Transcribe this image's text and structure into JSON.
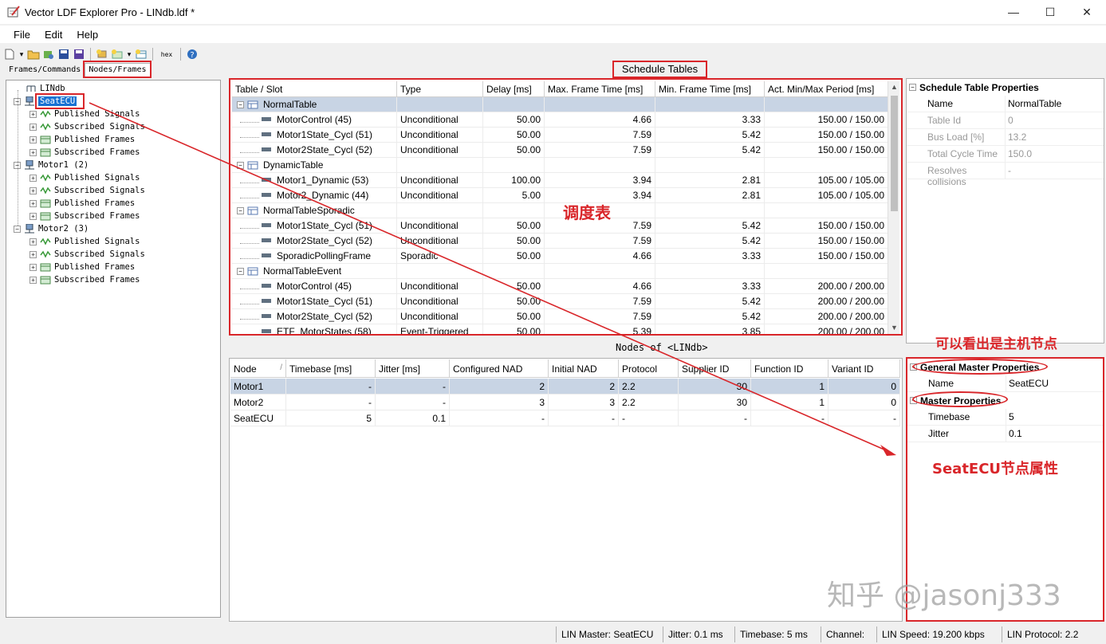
{
  "window": {
    "title": "Vector LDF Explorer Pro - LINdb.ldf *",
    "minimize": "—",
    "maximize": "☐",
    "close": "✕"
  },
  "menu": [
    "File",
    "Edit",
    "Help"
  ],
  "toolbar": {
    "hex": "hex"
  },
  "left_tabs": [
    "Frames/Commands",
    "Nodes/Frames"
  ],
  "tree": {
    "root": "LINdb",
    "nodes": [
      {
        "label": "SeatECU",
        "children": [
          "Published Signals",
          "Subscribed Signals",
          "Published Frames",
          "Subscribed Frames"
        ]
      },
      {
        "label": "Motor1 (2)",
        "children": [
          "Published Signals",
          "Subscribed Signals",
          "Published Frames",
          "Subscribed Frames"
        ]
      },
      {
        "label": "Motor2 (3)",
        "children": [
          "Published Signals",
          "Subscribed Signals",
          "Published Frames",
          "Subscribed Frames"
        ]
      }
    ]
  },
  "schedule": {
    "title": "Schedule Tables",
    "columns": [
      "Table / Slot",
      "Type",
      "Delay [ms]",
      "Max. Frame Time [ms]",
      "Min. Frame Time [ms]",
      "Act. Min/Max Period [ms]"
    ],
    "rows": [
      {
        "group": true,
        "name": "NormalTable"
      },
      {
        "name": "MotorControl (45)",
        "type": "Unconditional",
        "delay": "50.00",
        "max": "4.66",
        "min": "3.33",
        "period": "150.00 / 150.00"
      },
      {
        "name": "Motor1State_Cycl (51)",
        "type": "Unconditional",
        "delay": "50.00",
        "max": "7.59",
        "min": "5.42",
        "period": "150.00 / 150.00"
      },
      {
        "name": "Motor2State_Cycl (52)",
        "type": "Unconditional",
        "delay": "50.00",
        "max": "7.59",
        "min": "5.42",
        "period": "150.00 / 150.00"
      },
      {
        "group": true,
        "name": "DynamicTable"
      },
      {
        "name": "Motor1_Dynamic (53)",
        "type": "Unconditional",
        "delay": "100.00",
        "max": "3.94",
        "min": "2.81",
        "period": "105.00 / 105.00"
      },
      {
        "name": "Motor2_Dynamic (44)",
        "type": "Unconditional",
        "delay": "5.00",
        "max": "3.94",
        "min": "2.81",
        "period": "105.00 / 105.00"
      },
      {
        "group": true,
        "name": "NormalTableSporadic"
      },
      {
        "name": "Motor1State_Cycl (51)",
        "type": "Unconditional",
        "delay": "50.00",
        "max": "7.59",
        "min": "5.42",
        "period": "150.00 / 150.00"
      },
      {
        "name": "Motor2State_Cycl (52)",
        "type": "Unconditional",
        "delay": "50.00",
        "max": "7.59",
        "min": "5.42",
        "period": "150.00 / 150.00"
      },
      {
        "name": "SporadicPollingFrame",
        "type": "Sporadic",
        "delay": "50.00",
        "max": "4.66",
        "min": "3.33",
        "period": "150.00 / 150.00"
      },
      {
        "group": true,
        "name": "NormalTableEvent"
      },
      {
        "name": "MotorControl (45)",
        "type": "Unconditional",
        "delay": "50.00",
        "max": "4.66",
        "min": "3.33",
        "period": "200.00 / 200.00"
      },
      {
        "name": "Motor1State_Cycl (51)",
        "type": "Unconditional",
        "delay": "50.00",
        "max": "7.59",
        "min": "5.42",
        "period": "200.00 / 200.00"
      },
      {
        "name": "Motor2State_Cycl (52)",
        "type": "Unconditional",
        "delay": "50.00",
        "max": "7.59",
        "min": "5.42",
        "period": "200.00 / 200.00"
      },
      {
        "name": "ETF_MotorStates (58)",
        "type": "Event-Triggered",
        "delay": "50.00",
        "max": "5.39",
        "min": "3.85",
        "period": "200.00 / 200.00"
      }
    ]
  },
  "schedule_props": {
    "category": "Schedule Table Properties",
    "rows": [
      {
        "k": "Name",
        "v": "NormalTable",
        "dim": false
      },
      {
        "k": "Table Id",
        "v": "0",
        "dim": true
      },
      {
        "k": "Bus Load [%]",
        "v": "13.2",
        "dim": true
      },
      {
        "k": "Total Cycle Time",
        "v": "150.0",
        "dim": true
      },
      {
        "k": "Resolves collisions",
        "v": "-",
        "dim": true
      }
    ]
  },
  "nodes": {
    "title": "Nodes of <LINdb>",
    "columns": [
      "Node",
      "Timebase [ms]",
      "Jitter [ms]",
      "Configured NAD",
      "Initial NAD",
      "Protocol",
      "Supplier ID",
      "Function ID",
      "Variant ID"
    ],
    "sort_glyph": "/",
    "rows": [
      [
        "Motor1",
        "-",
        "-",
        "2",
        "2",
        "2.2",
        "30",
        "1",
        "0"
      ],
      [
        "Motor2",
        "-",
        "-",
        "3",
        "3",
        "2.2",
        "30",
        "1",
        "0"
      ],
      [
        "SeatECU",
        "5",
        "0.1",
        "-",
        "-",
        "-",
        "-",
        "-",
        "-"
      ]
    ]
  },
  "node_props": {
    "cat1": "General Master Properties",
    "cat1_rows": [
      {
        "k": "Name",
        "v": "SeatECU"
      }
    ],
    "cat2": "Master Properties",
    "cat2_rows": [
      {
        "k": "Timebase",
        "v": "5"
      },
      {
        "k": "Jitter",
        "v": "0.1"
      }
    ]
  },
  "status": [
    "LIN Master: SeatECU",
    "Jitter: 0.1 ms",
    "Timebase: 5 ms",
    "Channel:",
    "LIN Speed: 19.200 kbps",
    "LIN Protocol: 2.2"
  ],
  "annotations": {
    "schedule_note": "调度表",
    "master_note": "可以看出是主机节点",
    "seatecu_note": "SeatECU节点属性",
    "watermark": "知乎 @jasonj333",
    "accent": "#d9262a"
  }
}
